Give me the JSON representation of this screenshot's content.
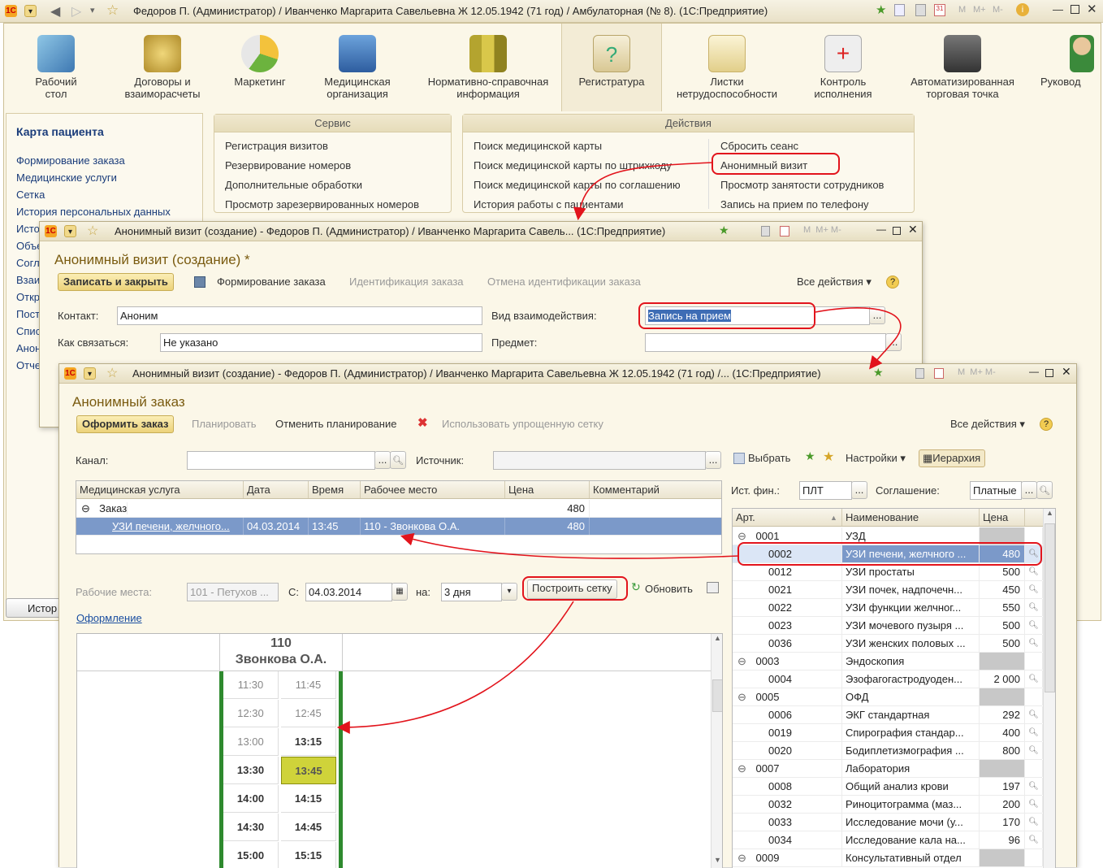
{
  "app_title": "Федоров П. (Администратор) / Иванченко Маргарита Савельевна Ж 12.05.1942 (71 год) / Амбулаторная (№ 8).  (1С:Предприятие)",
  "sections": [
    "Рабочий стол",
    "Договоры и взаиморасчеты",
    "Маркетинг",
    "Медицинская организация",
    "Нормативно-справочная информация",
    "Регистратура",
    "Листки нетрудоспособности",
    "Контроль исполнения",
    "Автоматизированная торговая точка",
    "Руковод"
  ],
  "left_panel": {
    "title": "Карта пациента",
    "items": [
      "Формирование заказа",
      "Медицинские услуги",
      "Сетка",
      "История персональных данных",
      "Исто",
      "Объе",
      "Согл",
      "Взаи",
      "Откр",
      "Пост",
      "Спис",
      "Анон",
      "Отче"
    ],
    "taskbar_item": "Истор"
  },
  "service_panel": {
    "header": "Сервис",
    "items": [
      "Регистрация визитов",
      "Резервирование номеров",
      "Дополнительные обработки",
      "Просмотр зарезервированных номеров"
    ]
  },
  "actions_panel": {
    "header": "Действия",
    "left_items": [
      "Поиск медицинской карты",
      "Поиск медицинской карты по штрихкоду",
      "Поиск медицинской карты по соглашению",
      "История работы с пациентами"
    ],
    "right_items": [
      "Сбросить сеанс",
      "Анонимный визит",
      "Просмотр занятости сотрудников",
      "Запись на прием по телефону"
    ]
  },
  "visit_window": {
    "title": "Анонимный визит (создание) - Федоров П. (Администратор) / Иванченко Маргарита Савель...  (1С:Предприятие)",
    "form_title": "Анонимный визит (создание) *",
    "save_close": "Записать и закрыть",
    "cmd_order": "Формирование заказа",
    "cmd_identify": "Идентификация заказа",
    "cmd_cancel_identify": "Отмена идентификации заказа",
    "all_actions": "Все действия",
    "contact_label": "Контакт:",
    "contact_value": "Аноним",
    "how_label": "Как связаться:",
    "how_value": "Не указано",
    "type_label": "Вид взаимодействия:",
    "type_value": "Запись на прием",
    "subject_label": "Предмет:",
    "subject_value": ""
  },
  "order_window": {
    "title": "Анонимный визит (создание) - Федоров П. (Администратор) / Иванченко Маргарита Савельевна Ж 12.05.1942 (71 год) /...  (1С:Предприятие)",
    "form_title": "Анонимный заказ",
    "btn_make": "Оформить заказ",
    "btn_plan": "Планировать",
    "btn_cancel_plan": "Отменить планирование",
    "btn_simple_grid": "Использовать упрощенную сетку",
    "all_actions": "Все действия",
    "channel_label": "Канал:",
    "channel_value": "",
    "source_label": "Источник:",
    "source_value": "",
    "columns": [
      "Медицинская услуга",
      "Дата",
      "Время",
      "Рабочее место",
      "Цена",
      "Комментарий"
    ],
    "group_row": {
      "name": "Заказ",
      "price": "480"
    },
    "item_row": {
      "service": "УЗИ печени, желчного...",
      "date": "04.03.2014",
      "time": "13:45",
      "place": "110 - Звонкова О.А.",
      "price": "480",
      "comment": ""
    },
    "workplace_label": "Рабочие места:",
    "workplace_value": "101 - Петухов ...",
    "from_label": "С:",
    "from_value": "04.03.2014",
    "on_label": "на:",
    "on_value": "3 дня",
    "build_grid": "Построить сетку",
    "refresh": "Обновить",
    "design_link": "Оформление",
    "schedule_header_num": "110",
    "schedule_header_name": "Звонкова О.А.",
    "slots": [
      {
        "left": "11:30",
        "right": "11:45",
        "bold": false
      },
      {
        "left": "12:30",
        "right": "12:45",
        "bold": false
      },
      {
        "left": "13:00",
        "right": "13:15",
        "bold": "right"
      },
      {
        "left": "13:30",
        "right": "13:45",
        "bold": true
      },
      {
        "left": "14:00",
        "right": "14:15",
        "bold": true
      },
      {
        "left": "14:30",
        "right": "14:45",
        "bold": true
      },
      {
        "left": "15:00",
        "right": "15:15",
        "bold": true
      }
    ],
    "selected_slot": "13:45",
    "right": {
      "choose": "Выбрать",
      "settings": "Настройки",
      "hierarchy": "Иерархия",
      "fin_label": "Ист. фин.:",
      "fin_value": "ПЛТ",
      "agreement_label": "Соглашение:",
      "agreement_value": "Платные",
      "columns": [
        "Арт.",
        "Наименование",
        "Цена"
      ],
      "rows": [
        {
          "art": "0001",
          "name": "УЗД",
          "price": "",
          "group": true
        },
        {
          "art": "0002",
          "name": "УЗИ печени, желчного ...",
          "price": "480",
          "group": false,
          "selected": true
        },
        {
          "art": "0012",
          "name": "УЗИ простаты",
          "price": "500",
          "group": false
        },
        {
          "art": "0021",
          "name": "УЗИ почек, надпочечн...",
          "price": "450",
          "group": false
        },
        {
          "art": "0022",
          "name": "УЗИ функции желчног...",
          "price": "550",
          "group": false
        },
        {
          "art": "0023",
          "name": "УЗИ мочевого пузыря ...",
          "price": "500",
          "group": false
        },
        {
          "art": "0036",
          "name": "УЗИ женских половых ...",
          "price": "500",
          "group": false
        },
        {
          "art": "0003",
          "name": "Эндоскопия",
          "price": "",
          "group": true
        },
        {
          "art": "0004",
          "name": "Эзофагогастродуоден...",
          "price": "2 000",
          "group": false
        },
        {
          "art": "0005",
          "name": "ОФД",
          "price": "",
          "group": true
        },
        {
          "art": "0006",
          "name": "ЭКГ стандартная",
          "price": "292",
          "group": false
        },
        {
          "art": "0019",
          "name": "Спирография стандар...",
          "price": "400",
          "group": false
        },
        {
          "art": "0020",
          "name": "Бодиплетизмография ...",
          "price": "800",
          "group": false
        },
        {
          "art": "0007",
          "name": "Лаборатория",
          "price": "",
          "group": true
        },
        {
          "art": "0008",
          "name": "Общий анализ крови",
          "price": "197",
          "group": false
        },
        {
          "art": "0032",
          "name": "Риноцитограмма (маз...",
          "price": "200",
          "group": false
        },
        {
          "art": "0033",
          "name": "Исследование мочи (у...",
          "price": "170",
          "group": false
        },
        {
          "art": "0034",
          "name": "Исследование кала на...",
          "price": "96",
          "group": false
        },
        {
          "art": "0009",
          "name": "Консультативный отдел",
          "price": "",
          "group": true
        }
      ]
    }
  }
}
